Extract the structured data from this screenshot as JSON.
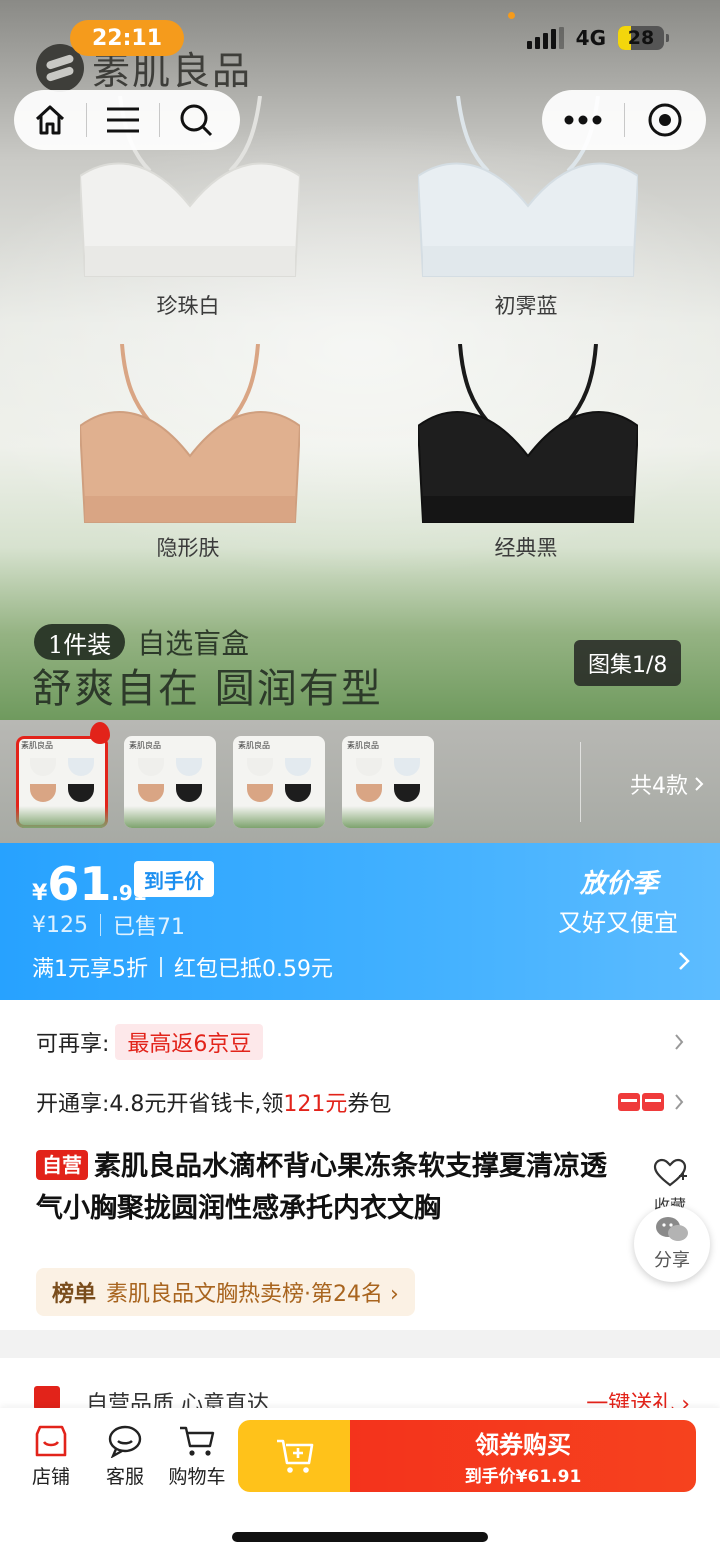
{
  "status": {
    "time": "22:11",
    "network": "4G",
    "battery": "28",
    "battery_fraction": 0.28
  },
  "hero": {
    "brand": "素肌良品",
    "colors": [
      {
        "name": "珍珠白",
        "swatch": "#f1f1ef"
      },
      {
        "name": "初霁蓝",
        "swatch": "#e6ecf0"
      },
      {
        "name": "隐形肤",
        "swatch": "#dfae8c"
      },
      {
        "name": "经典黑",
        "swatch": "#1d1d1d"
      }
    ],
    "pack_tag": "1件装",
    "pack_text": "自选盲盒",
    "slogan": "舒爽自在 圆润有型",
    "gallery_count": "图集1/8"
  },
  "thumbs": {
    "more_label": "共4款"
  },
  "price": {
    "currency": "¥",
    "integer": "61",
    "decimal": ".91",
    "tag": "到手价",
    "original": "¥125",
    "sold": "已售71",
    "promo1": "满1元享5折",
    "promo2": "红包已抵0.59元",
    "season_title": "放价季",
    "season_sub": "又好又便宜"
  },
  "info": {
    "rebate_label": "可再享:",
    "rebate_tag": "最高返6京豆",
    "card_label_a": "开通享:4.8元开省钱卡,领",
    "card_amount": "121元",
    "card_label_b": "券包",
    "self_tag": "自营",
    "title": "素肌良品水滴杯背心果冻条软支撑夏清凉透气小胸聚拢圆润性感承托内衣文胸",
    "fav_label": "收藏",
    "share_label": "分享",
    "rank_label": "榜单",
    "rank_text": "素肌良品文胸热卖榜·第24名 ›",
    "promise_text": "自营品质 心意直达",
    "gift_link": "一键送礼 ›"
  },
  "bottom": {
    "store": "店铺",
    "service": "客服",
    "cart": "购物车",
    "buy_main": "领券购买",
    "buy_sub": "到手价¥61.91"
  }
}
